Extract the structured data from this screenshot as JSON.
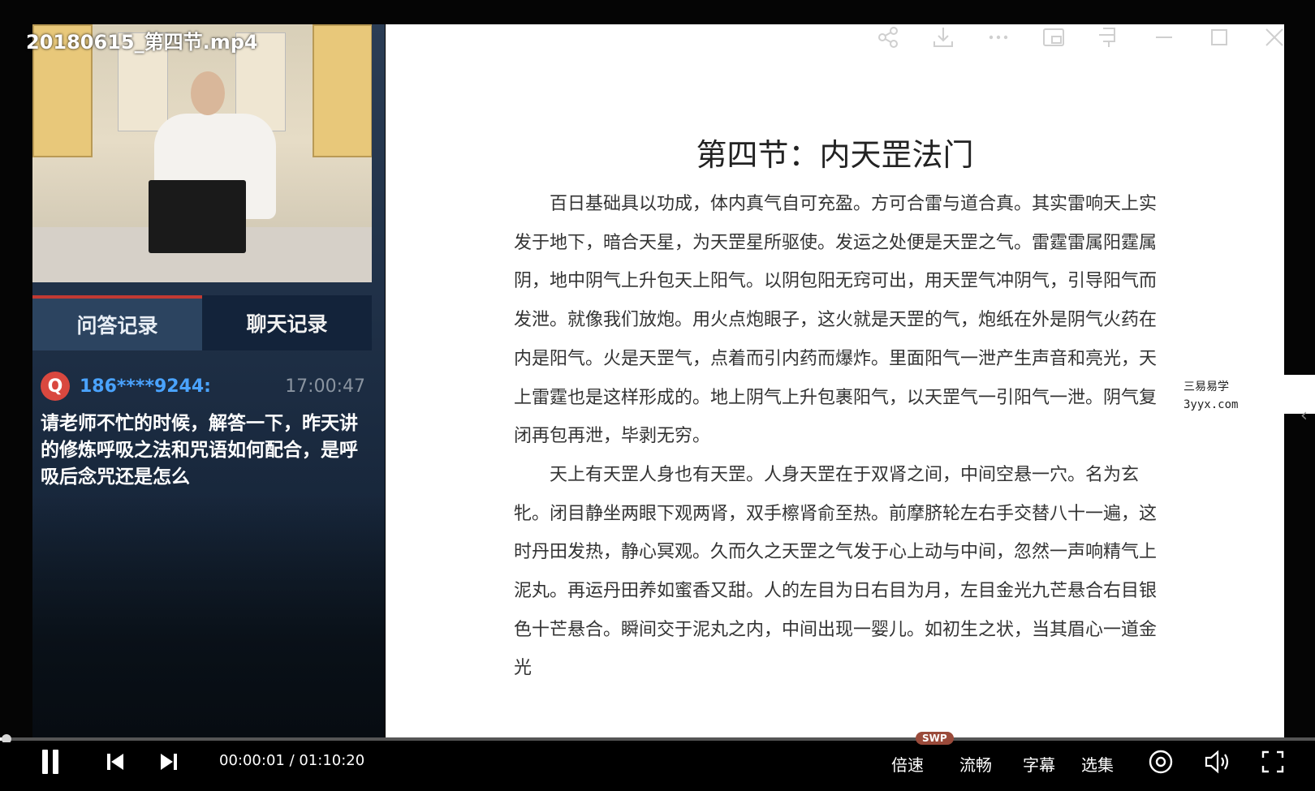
{
  "window": {
    "file_title": "20180615_第四节.mp4",
    "icons": [
      "share-icon",
      "download-icon",
      "more-icon",
      "picture-in-picture-icon",
      "pin-icon",
      "minimize-icon",
      "maximize-icon",
      "close-icon"
    ]
  },
  "panel": {
    "tabs": [
      {
        "label": "问答记录",
        "active": true
      },
      {
        "label": "聊天记录",
        "active": false
      }
    ],
    "message": {
      "badge": "Q",
      "user": "186****9244:",
      "time": "17:00:47",
      "text": "请老师不忙的时候，解答一下，昨天讲的修炼呼吸之法和咒语如何配合，是呼吸后念咒还是怎么"
    }
  },
  "slide": {
    "title": "第四节：内天罡法门",
    "paragraphs": [
      "百日基础具以功成，体内真气自可充盈。方可合雷与道合真。其实雷响天上实发于地下，暗合天星，为天罡星所驱使。发运之处便是天罡之气。雷霆雷属阳霆属阴，地中阴气上升包天上阳气。以阴包阳无窍可出，用天罡气冲阴气，引导阳气而发泄。就像我们放炮。用火点炮眼子，这火就是天罡的气，炮纸在外是阴气火药在内是阳气。火是天罡气，点着而引内药而爆炸。里面阳气一泄产生声音和亮光，天上雷霆也是这样形成的。地上阴气上升包裹阳气，以天罡气一引阳气一泄。阴气复闭再包再泄，毕剥无穷。",
      "天上有天罡人身也有天罡。人身天罡在于双肾之间，中间空悬一穴。名为玄牝。闭目静坐两眼下观两肾，双手檫肾俞至热。前摩脐轮左右手交替八十一遍，这时丹田发热，静心冥观。久而久之天罡之气发于心上动与中间，忽然一声响精气上泥丸。再运丹田养如蜜香又甜。人的左目为日右目为月，左目金光九芒悬合右目银色十芒悬合。瞬间交于泥丸之内，中间出现一婴儿。如初生之状，当其眉心一道金光"
    ]
  },
  "watermark": {
    "line1": "三易易学",
    "line2": "3yyx.com"
  },
  "player": {
    "current_time": "00:00:01",
    "separator": " / ",
    "total_time": "01:10:20",
    "progress": 0.0002,
    "badge": "SWP",
    "speed_label": "倍速",
    "quality_label": "流畅",
    "subtitle_label": "字幕",
    "episodes_label": "选集"
  }
}
